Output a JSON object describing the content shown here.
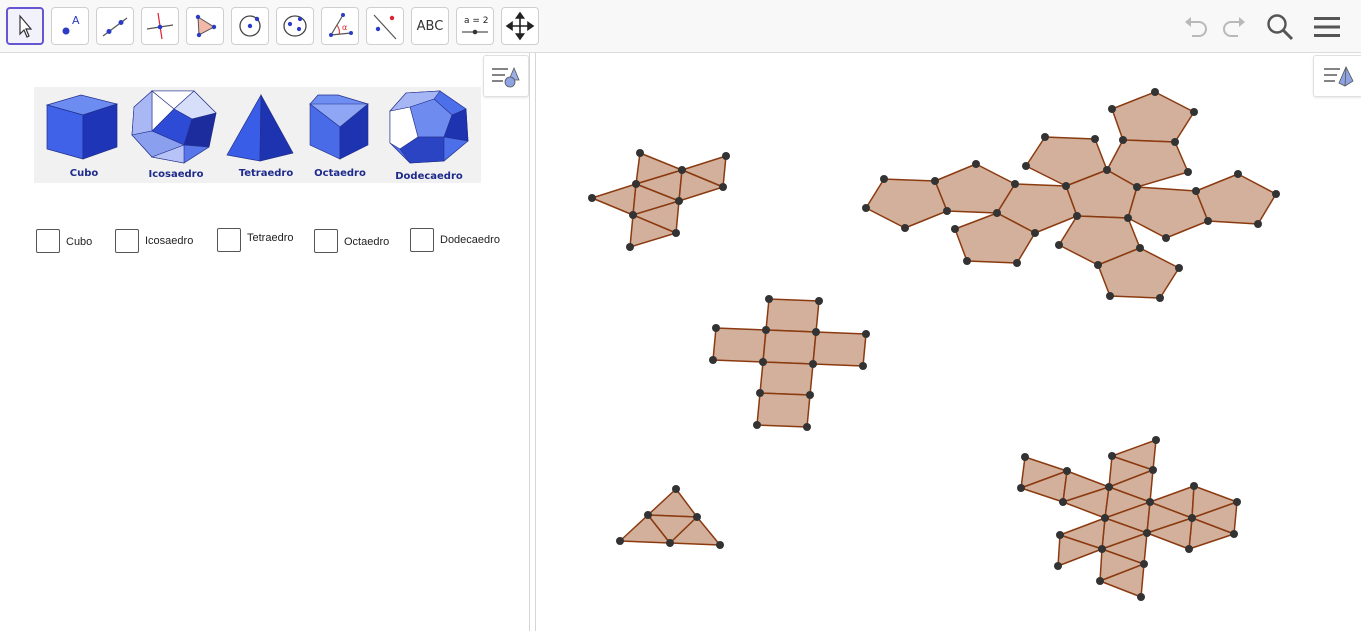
{
  "toolbar": {
    "tools": [
      {
        "name": "move-tool",
        "label": ""
      },
      {
        "name": "point-tool",
        "label": "A"
      },
      {
        "name": "line-tool",
        "label": ""
      },
      {
        "name": "perpendicular-tool",
        "label": ""
      },
      {
        "name": "polygon-tool",
        "label": ""
      },
      {
        "name": "circle-tool",
        "label": ""
      },
      {
        "name": "ellipse-tool",
        "label": ""
      },
      {
        "name": "angle-tool",
        "label": "α"
      },
      {
        "name": "reflect-tool",
        "label": ""
      },
      {
        "name": "text-tool",
        "label": "ABC"
      },
      {
        "name": "slider-tool",
        "label": "a = 2"
      },
      {
        "name": "move-graphics-tool",
        "label": ""
      }
    ],
    "icons": [
      "undo-icon",
      "redo-icon",
      "search-icon",
      "menu-icon"
    ]
  },
  "algebra": {
    "image_captions": [
      "Cubo",
      "Icosaedro",
      "Tetraedro",
      "Octaedro",
      "Dodecaedro"
    ],
    "checkboxes": [
      {
        "label": "Cubo",
        "checked": false
      },
      {
        "label": "Icosaedro",
        "checked": false
      },
      {
        "label": "Tetraedro",
        "checked": false
      },
      {
        "label": "Octaedro",
        "checked": false
      },
      {
        "label": "Dodecaedro",
        "checked": false
      }
    ]
  },
  "colors": {
    "net_fill": "#d2b09b",
    "net_stroke": "#8b3a10",
    "point": "#333333",
    "solid_blue": "#3a5bd9",
    "tool_selected": "#6557d2"
  }
}
